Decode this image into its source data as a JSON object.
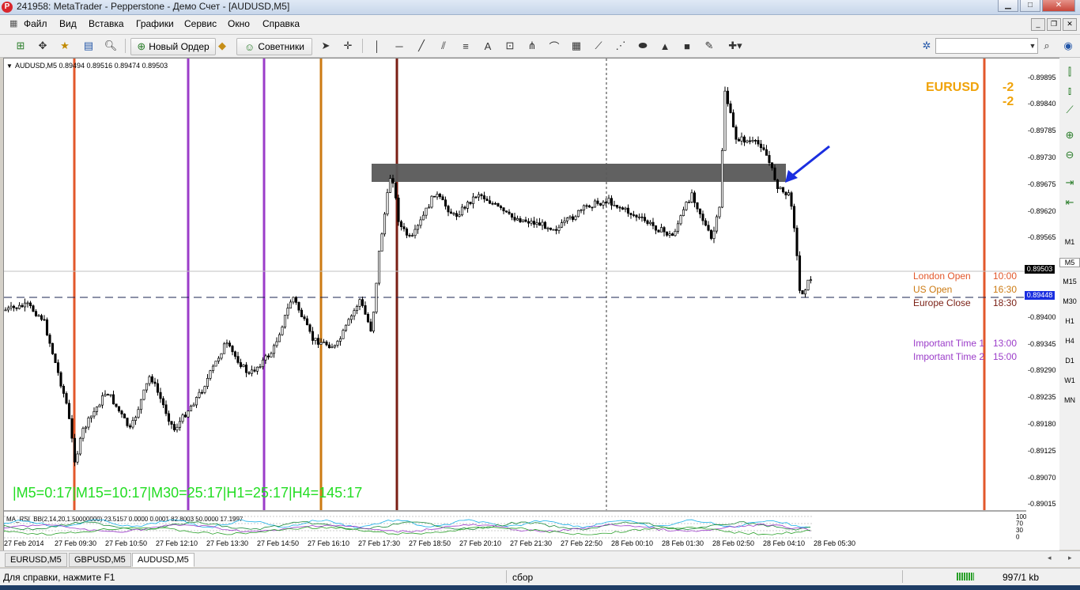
{
  "window": {
    "title": "241958: MetaTrader - Pepperstone - Демо Счет - [AUDUSD,M5]",
    "app_icon_letter": "P"
  },
  "menu": [
    "Файл",
    "Вид",
    "Вставка",
    "Графики",
    "Сервис",
    "Окно",
    "Справка"
  ],
  "toolbar": {
    "new_order_label": "Новый Ордер",
    "experts_label": "Советники"
  },
  "chart": {
    "header": "AUDUSD,M5  0.89494 0.89516 0.89474 0.89503",
    "timer_text": "|M5=0:17|M15=10:17|M30=25:17|H1=25:17|H4=145:17",
    "corner_symbols": [
      {
        "symbol": "EURUSD",
        "value": "-2"
      },
      {
        "symbol": "",
        "value": "-2"
      }
    ],
    "price_labels": [
      "0.89895",
      "0.89840",
      "0.89785",
      "0.89730",
      "0.89675",
      "0.89620",
      "0.89565",
      "0.89503",
      "0.89448",
      "0.89400",
      "0.89345",
      "0.89290",
      "0.89235",
      "0.89180",
      "0.89125",
      "0.89070",
      "0.89015"
    ],
    "current_price": "0.89503",
    "line_price": "0.89448",
    "sessions": [
      {
        "name": "London Open",
        "time": "10:00",
        "color": "#e2572a"
      },
      {
        "name": "US Open",
        "time": "16:30",
        "color": "#cc7a12"
      },
      {
        "name": "Europe Close",
        "time": "18:30",
        "color": "#7a1f14"
      },
      {
        "name": "Important Time 1",
        "time": "13:00",
        "color": "#9b3cc9"
      },
      {
        "name": "Important Time 2",
        "time": "15:00",
        "color": "#9b3cc9"
      }
    ],
    "indicator_label": "MA_RSI_BB(2,14,20,1.50000000) 23.5157 0.0000 0.0001 82.8003 50.0000 17.1997",
    "indicator_levels": [
      "100",
      "70",
      "30",
      "0"
    ],
    "time_labels": [
      "27 Feb 2014",
      "27 Feb 09:30",
      "27 Feb 10:50",
      "27 Feb 12:10",
      "27 Feb 13:30",
      "27 Feb 14:50",
      "27 Feb 16:10",
      "27 Feb 17:30",
      "27 Feb 18:50",
      "27 Feb 20:10",
      "27 Feb 21:30",
      "27 Feb 22:50",
      "28 Feb 00:10",
      "28 Feb 01:30",
      "28 Feb 02:50",
      "28 Feb 04:10",
      "28 Feb 05:30"
    ],
    "accent_color": "#1a2ee0"
  },
  "timeframes": [
    "M1",
    "M5",
    "M15",
    "M30",
    "H1",
    "H4",
    "D1",
    "W1",
    "MN"
  ],
  "tabs": [
    "EURUSD,M5",
    "GBPUSD,M5",
    "AUDUSD,M5"
  ],
  "status": {
    "help": "Для справки, нажмите F1",
    "profile": "сбор",
    "traffic": "997/1 kb"
  }
}
